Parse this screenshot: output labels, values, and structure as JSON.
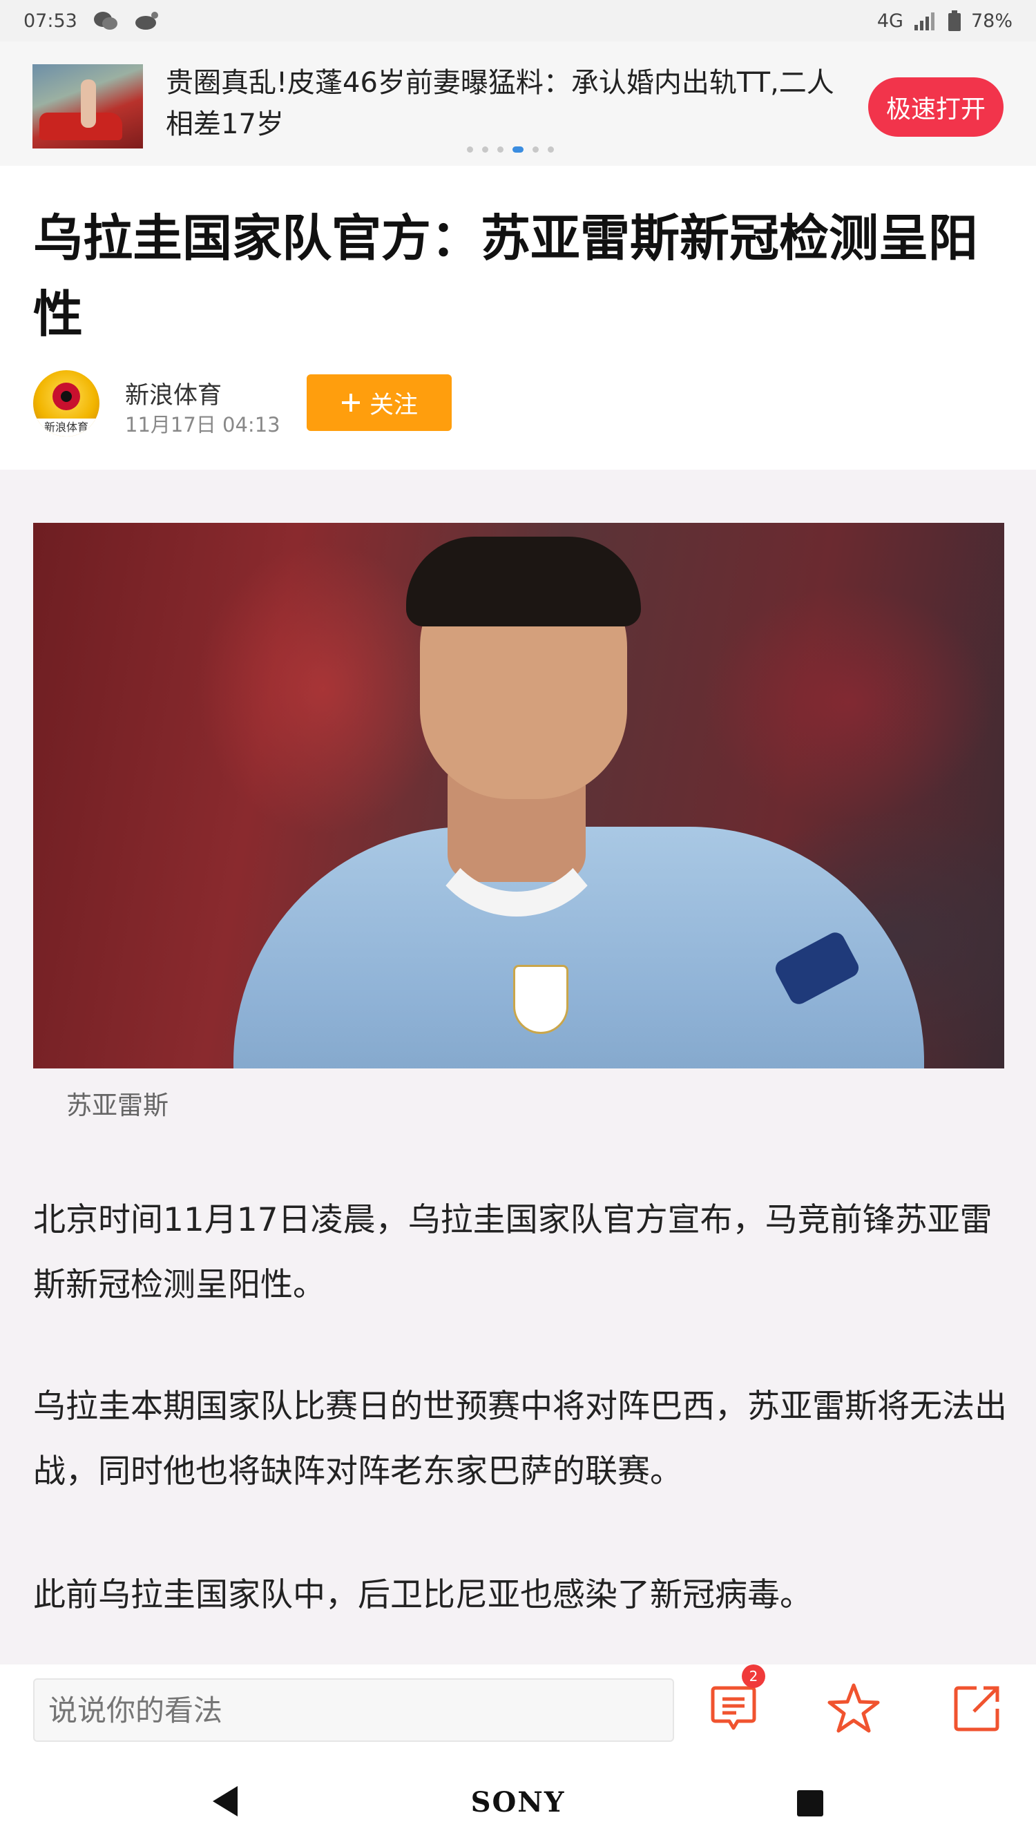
{
  "status_bar": {
    "time": "07:53",
    "network": "4G",
    "battery": "78%",
    "icons": [
      "wechat-icon",
      "weibo-icon",
      "signal-icon",
      "battery-icon"
    ]
  },
  "ad": {
    "text": "贵圈真乱!皮蓬46岁前妻曝猛料：承认婚内出轨TT,二人相差17岁",
    "button_label": "极速打开",
    "carousel_dots": 6,
    "active_dot": 3
  },
  "article": {
    "title": "乌拉圭国家队官方：苏亚雷斯新冠检测呈阳性",
    "author": "新浪体育",
    "avatar_label": "新浪体育",
    "publish_time": "11月17日  04:13",
    "follow_label": "关注",
    "image_caption": "苏亚雷斯",
    "paragraphs": [
      "北京时间11月17日凌晨，乌拉圭国家队官方宣布，马竞前锋苏亚雷斯新冠检测呈阳性。",
      "乌拉圭本期国家队比赛日的世预赛中将对阵巴西，苏亚雷斯将无法出战，同时他也将缺阵对阵老东家巴萨的联赛。",
      "此前乌拉圭国家队中，后卫比尼亚也感染了新冠病毒。"
    ]
  },
  "comment_bar": {
    "placeholder": "说说你的看法",
    "comment_count": "2"
  },
  "nav_bar": {
    "logo": "SONY"
  },
  "colors": {
    "ad_button": "#f2344b",
    "follow_button": "#ff9e0d",
    "action_icons": "#f0532f",
    "badge": "#f03a3a",
    "active_dot": "#3b8de0"
  }
}
